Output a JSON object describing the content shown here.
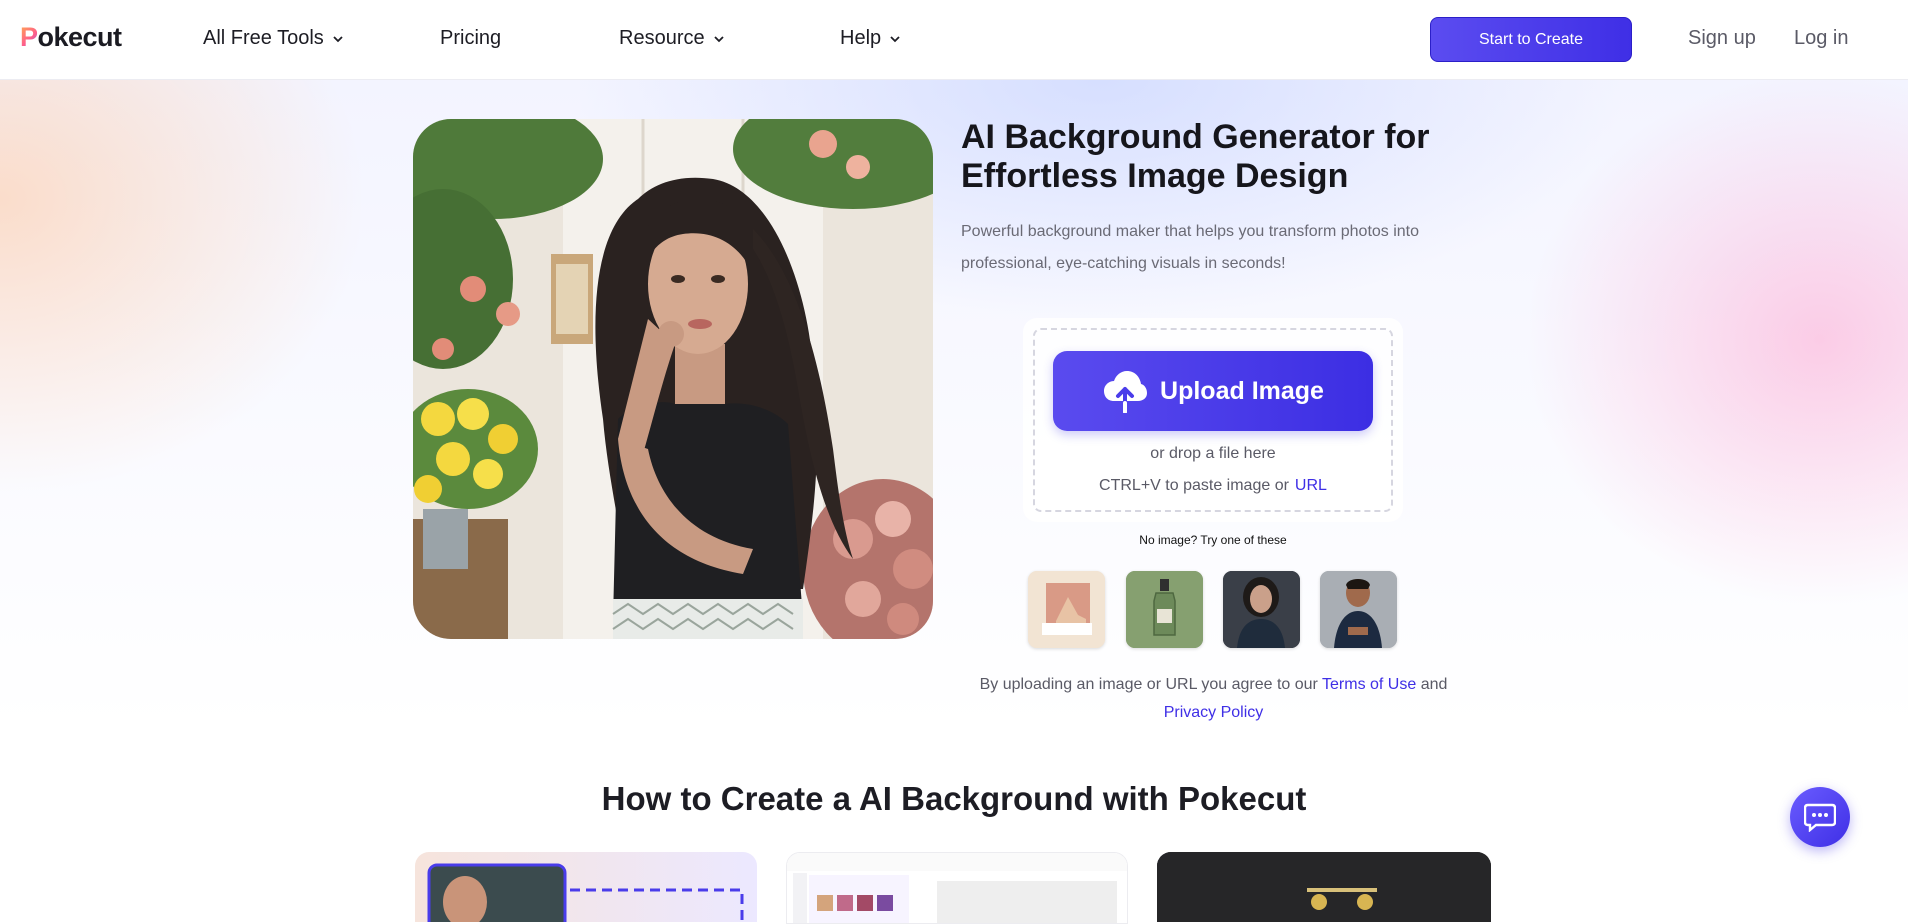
{
  "header": {
    "logo": "Pokecut",
    "nav": [
      {
        "label": "All Free Tools",
        "has_dropdown": true
      },
      {
        "label": "Pricing",
        "has_dropdown": false
      },
      {
        "label": "Resource",
        "has_dropdown": true
      },
      {
        "label": "Help",
        "has_dropdown": true
      }
    ],
    "cta_label": "Start to Create",
    "signup_label": "Sign up",
    "login_label": "Log in"
  },
  "hero": {
    "title": "AI Background Generator for Effortless Image Design",
    "subtitle": "Powerful background maker that helps you transform photos into professional, eye-catching visuals in seconds!",
    "upload": {
      "button_label": "Upload Image",
      "drop_text": "or drop a file here",
      "paste_text": "CTRL+V to paste image or",
      "url_label": "URL"
    },
    "samples_label": "No image? Try one of these",
    "samples": [
      {
        "icon": "sample-shoe-icon"
      },
      {
        "icon": "sample-bottle-icon"
      },
      {
        "icon": "sample-woman-icon"
      },
      {
        "icon": "sample-man-icon"
      }
    ],
    "agree_text": "By uploading an image or URL you agree to our",
    "terms_label": "Terms of Use",
    "and_text": "and",
    "privacy_label": "Privacy Policy"
  },
  "howto": {
    "title": "How to Create a AI Background with Pokecut"
  },
  "colors": {
    "accent": "#3f2fe6",
    "accent_light": "#5a4bef",
    "text": "#1d1d24",
    "muted": "#6a6a75"
  }
}
